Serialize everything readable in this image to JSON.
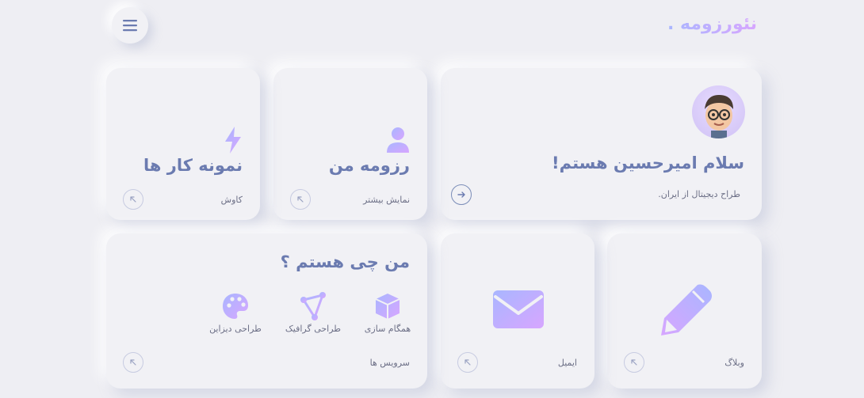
{
  "header": {
    "brand": "نئورزومه .",
    "menu_icon": "hamburger-icon"
  },
  "cards": {
    "intro": {
      "title": "سلام امیرحسین هستم!",
      "subtitle": "طراح دیجیتال از ایران.",
      "avatar": "memoji-avatar",
      "action_icon": "arrow-right-icon"
    },
    "resume": {
      "title": "رزومه من",
      "subtitle": "نمایش بیشتر",
      "icon": "user-icon",
      "action_icon": "arrow-up-left-icon"
    },
    "works": {
      "title": "نمونه کار ها",
      "subtitle": "کاوش",
      "icon": "lightning-icon",
      "action_icon": "arrow-up-left-icon"
    },
    "blog": {
      "subtitle": "وبلاگ",
      "icon": "pencil-icon",
      "action_icon": "arrow-up-left-icon"
    },
    "email": {
      "subtitle": "ایمیل",
      "icon": "envelope-icon",
      "action_icon": "arrow-up-left-icon"
    },
    "services": {
      "title": "من چی هستم ؟",
      "subtitle": "سرویس ها",
      "action_icon": "arrow-up-left-icon",
      "items": [
        {
          "label": "همگام سازی",
          "icon": "cube-icon"
        },
        {
          "label": "طراحی گرافیک",
          "icon": "vector-icon"
        },
        {
          "label": "طراحی دیزاین",
          "icon": "palette-icon"
        }
      ]
    }
  },
  "colors": {
    "accent_gradient_start": "#a9b6ff",
    "accent_gradient_end": "#d7a6ff",
    "title_text": "#6b7bb0",
    "background": "#eeeef3"
  }
}
